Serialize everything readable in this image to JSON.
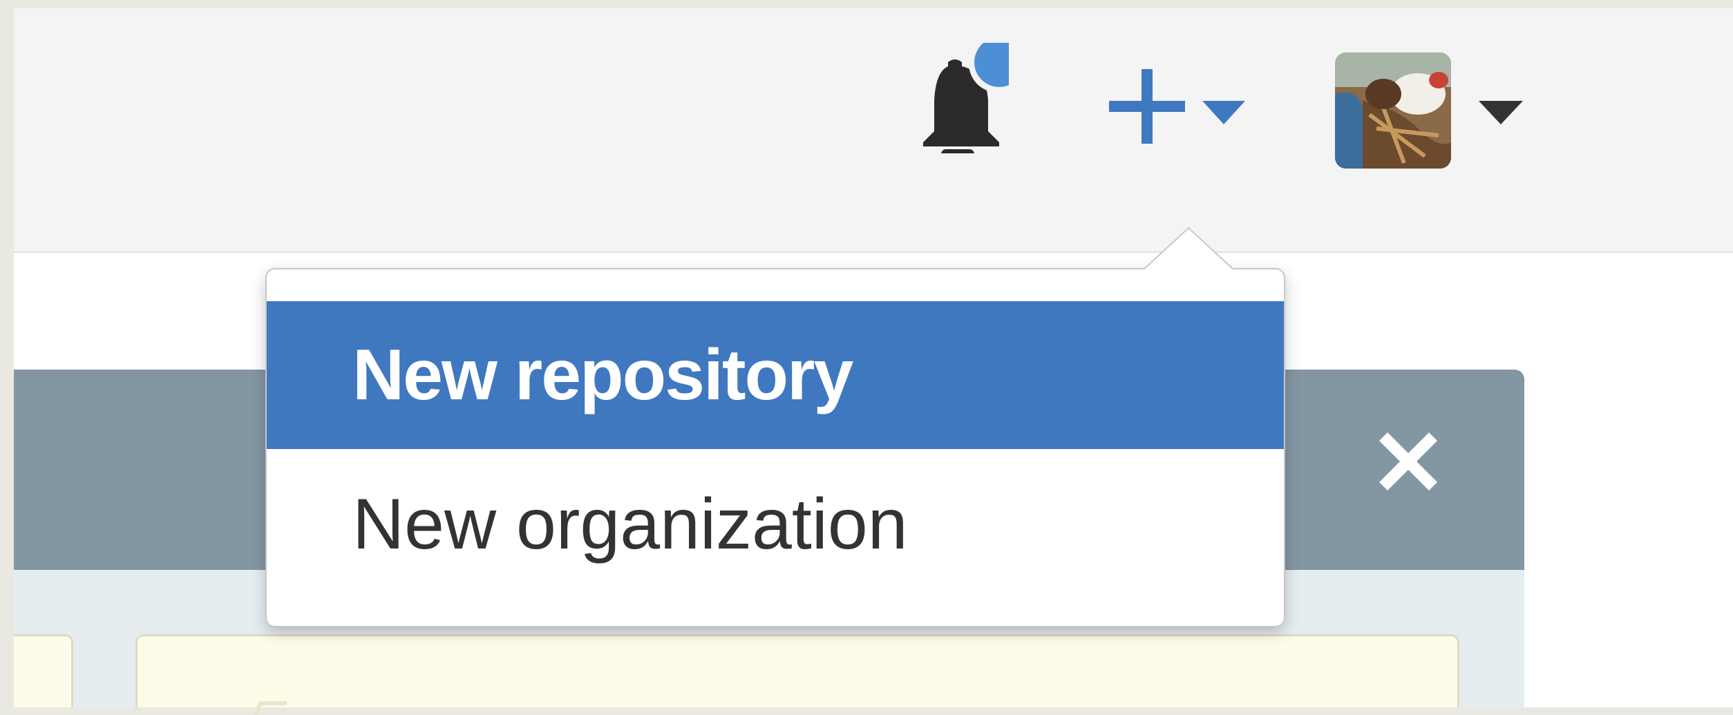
{
  "header": {
    "notifications_icon": "bell-icon",
    "notification_indicator": "unread-dot",
    "create_icon": "plus-icon",
    "create_caret_icon": "caret-down-icon",
    "profile_caret_icon": "caret-down-icon"
  },
  "create_menu": {
    "items": [
      {
        "label": "New repository",
        "state": "highlighted"
      },
      {
        "label": "New organization",
        "state": "default"
      }
    ]
  },
  "panel": {
    "close_icon": "close-icon"
  },
  "colors": {
    "accent": "#4078c0",
    "notification_dot": "#4c8fd6",
    "header_bg": "#f4f4f4",
    "panel_header": "#8397a3",
    "card_bg": "#fcfce9",
    "menu_text": "#333333"
  }
}
